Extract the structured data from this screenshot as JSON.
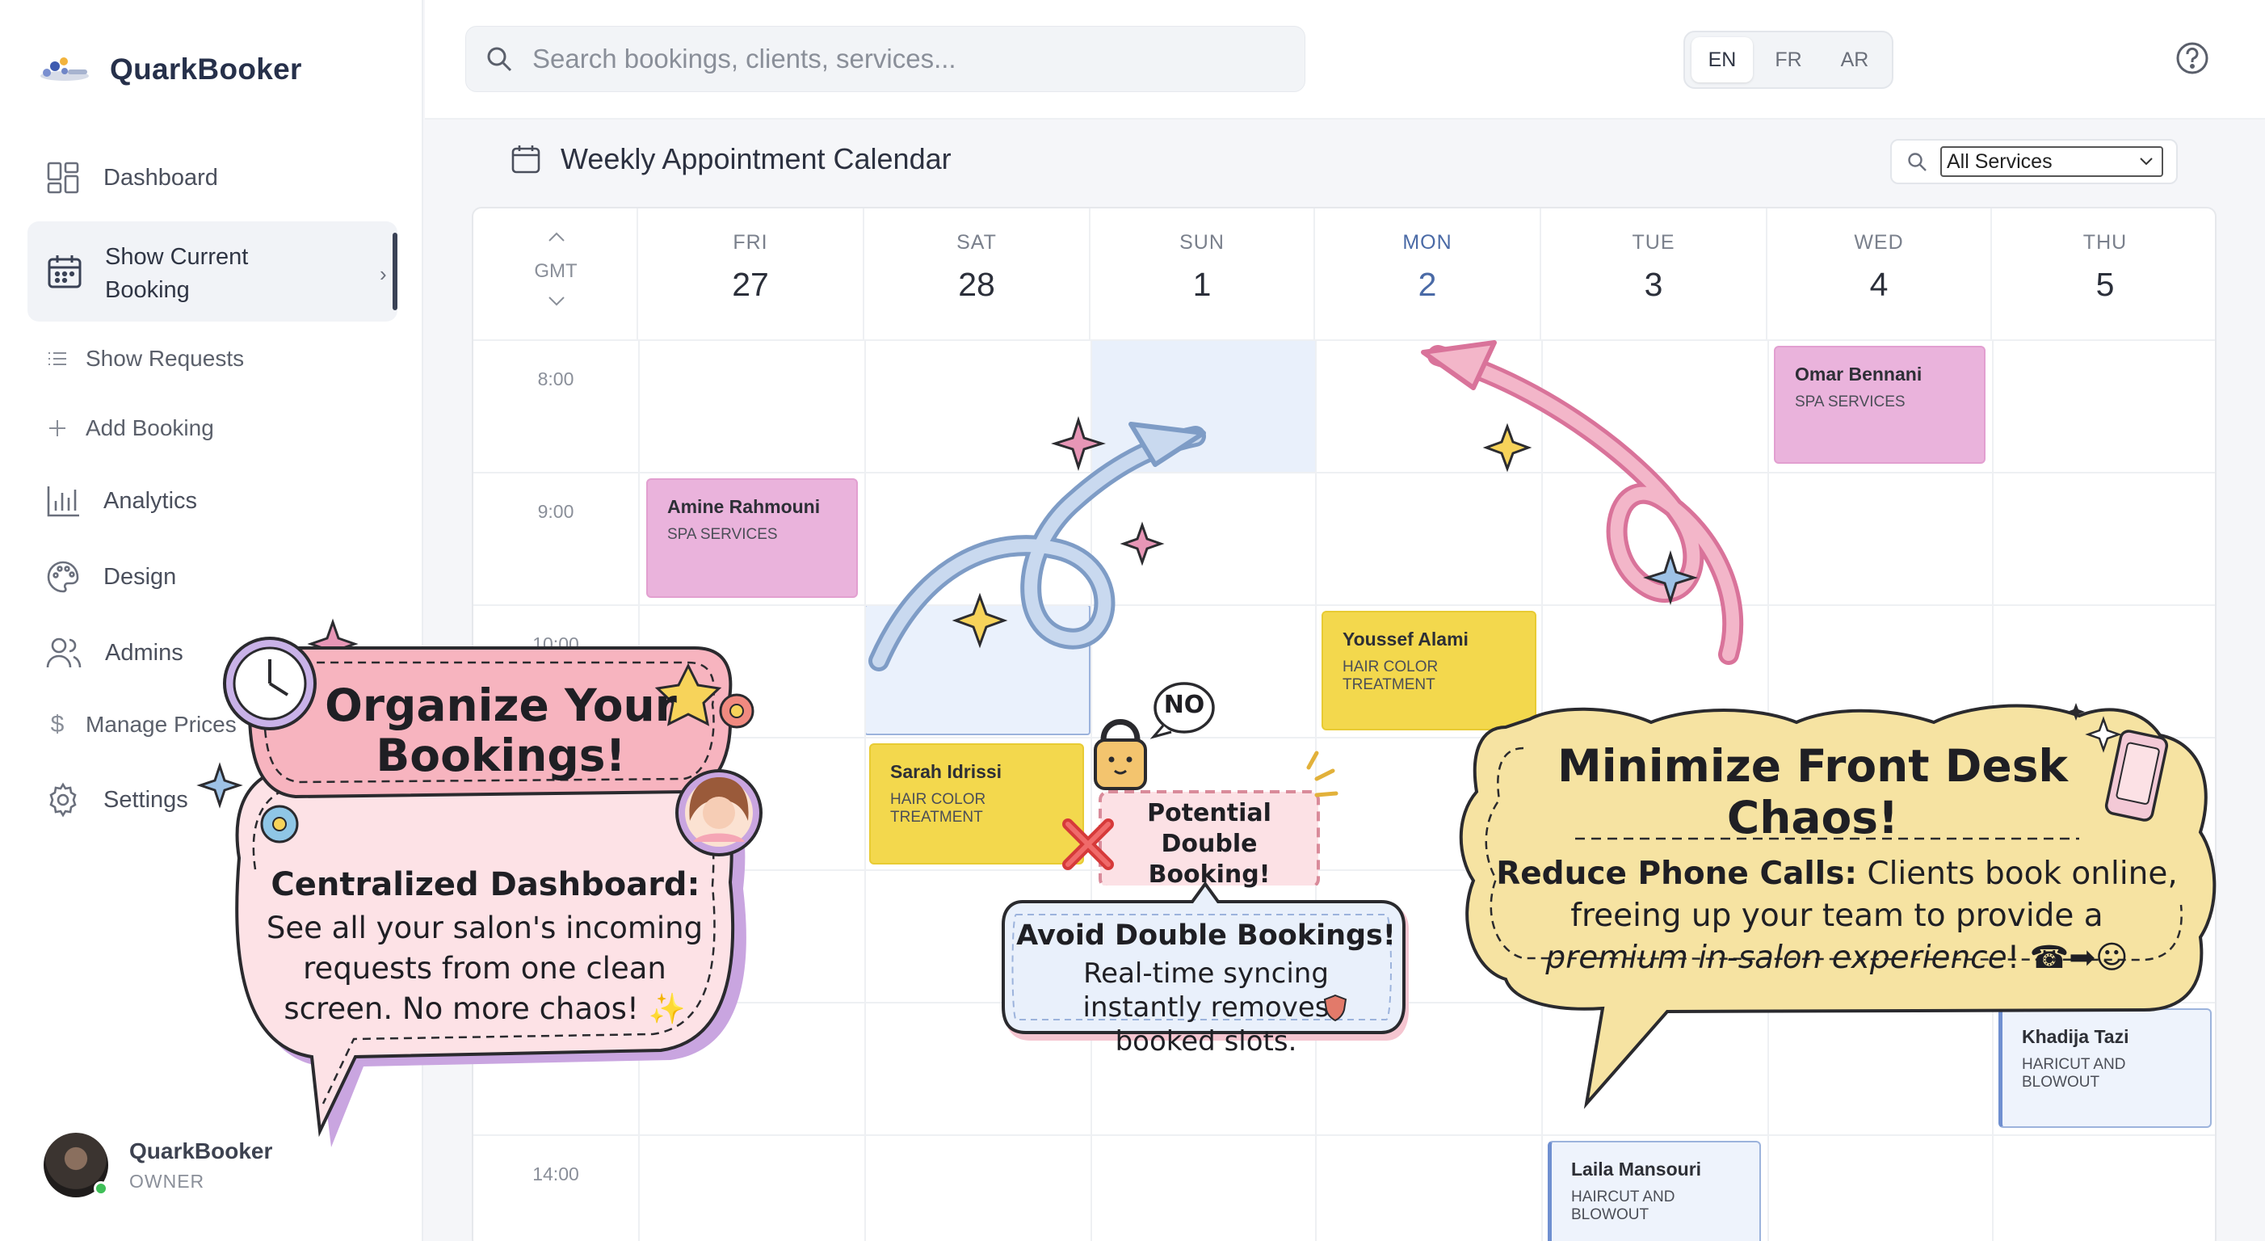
{
  "app": {
    "name": "QuarkBooker"
  },
  "sidebar": {
    "items": [
      {
        "label": "Dashboard",
        "icon": "dashboard-icon"
      },
      {
        "label": "Show Current Booking",
        "icon": "calendar-icon"
      },
      {
        "label": "Show Requests",
        "icon": "list-icon"
      },
      {
        "label": "Add Booking",
        "icon": "plus-icon"
      },
      {
        "label": "Analytics",
        "icon": "bar-chart-icon"
      },
      {
        "label": "Design",
        "icon": "palette-icon"
      },
      {
        "label": "Admins",
        "icon": "users-icon"
      },
      {
        "label": "Manage Prices",
        "icon": "dollar-icon"
      },
      {
        "label": "Settings",
        "icon": "gear-icon"
      }
    ],
    "user": {
      "name": "QuarkBooker",
      "role": "OWNER"
    }
  },
  "topbar": {
    "search_placeholder": "Search bookings, clients, services...",
    "languages": [
      "EN",
      "FR",
      "AR"
    ],
    "active_language": "EN"
  },
  "calendar": {
    "title": "Weekly Appointment Calendar",
    "filter_value": "All Services",
    "timezone_label": "GMT",
    "days": [
      {
        "name": "FRI",
        "date": "27"
      },
      {
        "name": "SAT",
        "date": "28"
      },
      {
        "name": "SUN",
        "date": "1"
      },
      {
        "name": "MON",
        "date": "2"
      },
      {
        "name": "TUE",
        "date": "3"
      },
      {
        "name": "WED",
        "date": "4"
      },
      {
        "name": "THU",
        "date": "5"
      }
    ],
    "times": [
      "8:00",
      "9:00",
      "10:00",
      "14:00"
    ],
    "appointments": [
      {
        "client": "Omar Bennani",
        "service": "SPA SERVICES"
      },
      {
        "client": "Amine Rahmouni",
        "service": "SPA SERVICES"
      },
      {
        "client": "Youssef Alami",
        "service": "HAIR COLOR TREATMENT"
      },
      {
        "client": "Sarah Idrissi",
        "service": "HAIR COLOR TREATMENT"
      },
      {
        "client": "Khadija Tazi",
        "service": "HARICUT AND BLOWOUT"
      },
      {
        "client": "Laila Mansouri",
        "service": "HAIRCUT AND BLOWOUT"
      }
    ]
  },
  "promo": {
    "left": {
      "title": "Organize Your Bookings!",
      "subtitle": "Centralized Dashboard:",
      "body": "See all your salon's incoming requests from one clean screen. No more chaos! ✨"
    },
    "warning": {
      "badge": "NO",
      "text": "Potential Double Booking!"
    },
    "center": {
      "title": "Avoid Double Bookings!",
      "body": "Real-time syncing instantly removes booked slots."
    },
    "right": {
      "title": "Minimize Front Desk Chaos!",
      "lead": "Reduce Phone Calls:",
      "body": " Clients book online, freeing up your team to provide a",
      "emphasis": "premium in-salon experience",
      "tail": "! ☎➡☺"
    }
  },
  "colors": {
    "spa": "#eab3dc",
    "color_treatment": "#f3d84d",
    "haircut": "#eef3fc",
    "accent": "#4a6aa6"
  }
}
